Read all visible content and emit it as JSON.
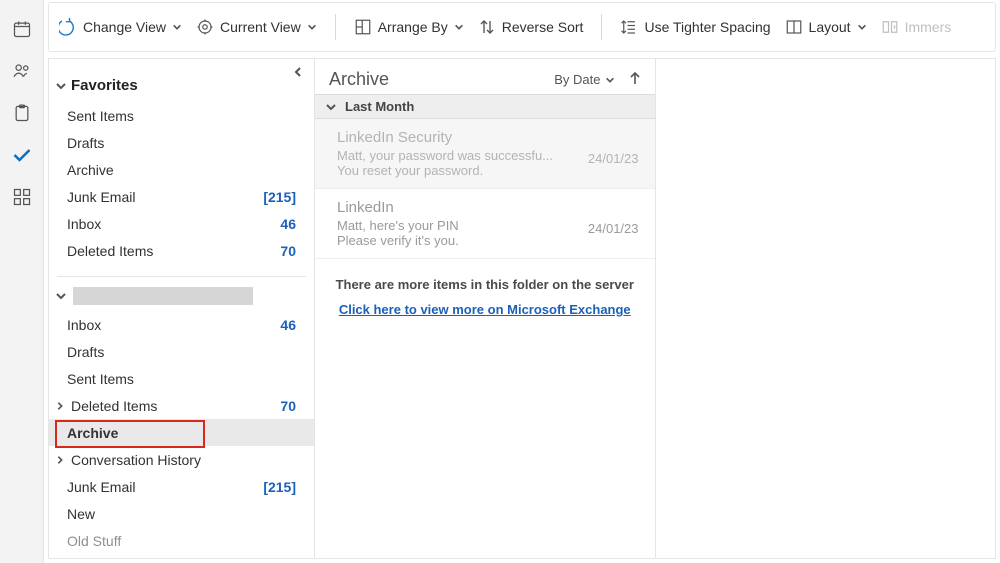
{
  "toolbar": {
    "change_view": "Change View",
    "current_view": "Current View",
    "arrange_by": "Arrange By",
    "reverse_sort": "Reverse Sort",
    "tighter_spacing": "Use Tighter Spacing",
    "layout": "Layout",
    "immersive": "Immers"
  },
  "folderpane": {
    "favorites": "Favorites",
    "fav_items": [
      {
        "label": "Sent Items",
        "count": ""
      },
      {
        "label": "Drafts",
        "count": ""
      },
      {
        "label": "Archive",
        "count": ""
      },
      {
        "label": "Junk Email",
        "count": "[215]"
      },
      {
        "label": "Inbox",
        "count": "46"
      },
      {
        "label": "Deleted Items",
        "count": "70"
      }
    ],
    "acct_items": [
      {
        "label": "Inbox",
        "count": "46"
      },
      {
        "label": "Drafts",
        "count": ""
      },
      {
        "label": "Sent Items",
        "count": ""
      },
      {
        "label": "Deleted Items",
        "count": "70",
        "expand": true
      },
      {
        "label": "Archive",
        "count": "",
        "selected": true,
        "highlighted": true
      },
      {
        "label": "Conversation History",
        "count": "",
        "expand": true
      },
      {
        "label": "Junk Email",
        "count": "[215]"
      },
      {
        "label": "New",
        "count": ""
      },
      {
        "label": "Old Stuff",
        "count": ""
      }
    ]
  },
  "listpane": {
    "title": "Archive",
    "sort_label": "By Date",
    "group": "Last Month",
    "server_line1": "There are more items in this folder on the server",
    "server_link": "Click here to view more on Microsoft Exchange",
    "messages": [
      {
        "sender": "LinkedIn Security",
        "subject": "Matt, your password was successfu...",
        "preview": "You reset your password.",
        "date": "24/01/23"
      },
      {
        "sender": "LinkedIn",
        "subject": "Matt, here's your PIN",
        "preview": "Please verify it's you.",
        "date": "24/01/23"
      }
    ]
  }
}
